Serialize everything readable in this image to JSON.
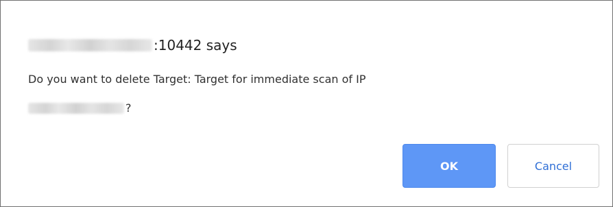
{
  "dialog": {
    "title_suffix": ":10442 says",
    "message_line1": "Do you want to delete Target: Target for immediate scan of IP",
    "message_line2_suffix": "?",
    "ok_label": "OK",
    "cancel_label": "Cancel"
  },
  "colors": {
    "ok_background": "#5e97f6",
    "cancel_text": "#2f6fd6",
    "border": "#6f6f6f"
  }
}
